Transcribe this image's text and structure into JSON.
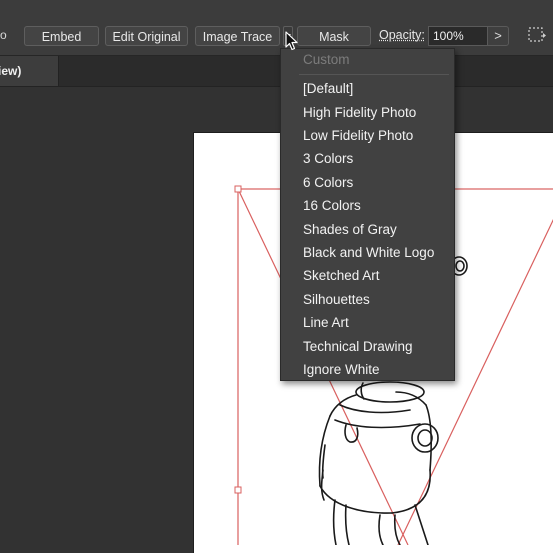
{
  "control_bar": {
    "clipped_text": "o",
    "embed_label": "Embed",
    "edit_original_label": "Edit Original",
    "image_trace_label": "Image Trace",
    "mask_label": "Mask",
    "opacity_label": "Opacity:",
    "opacity_value": "100%",
    "opacity_arrow": ">"
  },
  "tab": {
    "label": "iew)"
  },
  "trace_presets_menu": {
    "header": "Custom",
    "items": [
      "[Default]",
      "High Fidelity Photo",
      "Low Fidelity Photo",
      "3 Colors",
      "6 Colors",
      "16 Colors",
      "Shades of Gray",
      "Black and White Logo",
      "Sketched Art",
      "Silhouettes",
      "Line Art",
      "Technical Drawing",
      "Ignore White"
    ]
  },
  "colors": {
    "bounding_box": "#d9605f",
    "sketch": "#1a1a1a"
  }
}
